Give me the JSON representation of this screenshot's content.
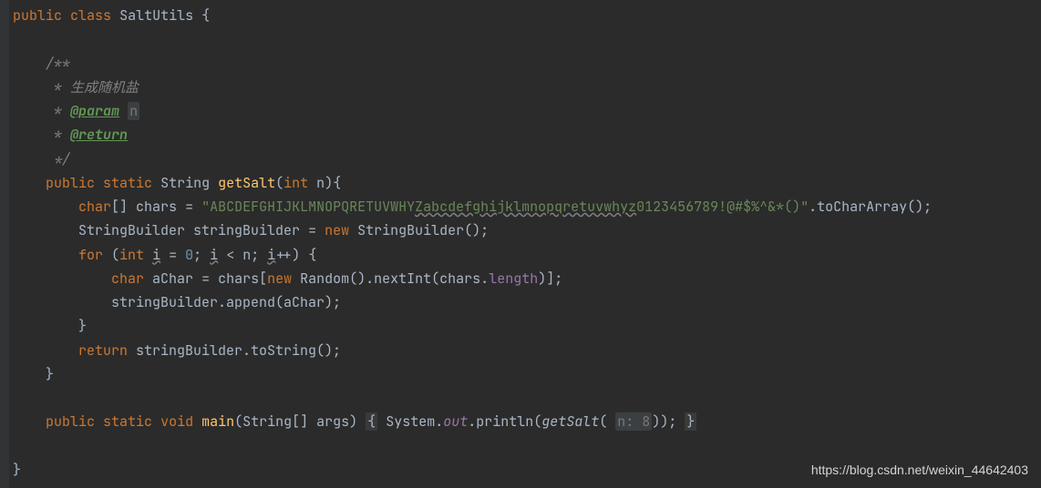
{
  "code": {
    "class_decl_public": "public",
    "class_decl_class": "class",
    "class_name": "SaltUtils",
    "brace_open": "{",
    "brace_close": "}",
    "doc_open": "/**",
    "doc_star": " *",
    "doc_desc": "生成随机盐",
    "doc_param_tag": "@param",
    "doc_param_name": "n",
    "doc_return_tag": "@return",
    "doc_close": " */",
    "m1_public": "public",
    "m1_static": "static",
    "m1_ret": "String",
    "m1_name": "getSalt",
    "m1_paren_open": "(",
    "m1_param_type": "int",
    "m1_param_name": "n",
    "m1_paren_close": ")",
    "char_kw": "char",
    "chars_var": "chars",
    "eq": "=",
    "charset_str_upper": "\"ABCDEFGHIJKLMNOPQRETUVWHY",
    "charset_str_lower": "Zabcdefghijklmnopqretuvwhyz",
    "charset_str_tail": "0123456789!@#$%^&*()\"",
    "to_char_array": ".toCharArray();",
    "sb_type": "StringBuilder",
    "sb_var": "stringBuilder",
    "new_kw": "new",
    "sb_ctor": "StringBuilder();",
    "for_kw": "for",
    "int_kw": "int",
    "i_var": "i",
    "zero": "0",
    "lt": "<",
    "n_var": "n",
    "inc": "++",
    "achar_var": "aChar",
    "chars_idx": "chars[",
    "random_type": "Random",
    "random_ctor": "().nextInt(chars.",
    "length_field": "length",
    "idx_close": ")];",
    "append_call": "stringBuilder.append(aChar);",
    "return_kw": "return",
    "tostring_call": "stringBuilder.toString();",
    "m2_ret": "void",
    "m2_name": "main",
    "m2_params": "(String[] args)",
    "fold_open": "{",
    "sys_out": "System.",
    "out_field": "out",
    "println": ".println(",
    "getsalt_call": "getSalt",
    "hint_label": "n:",
    "hint_val": "8",
    "call_close": "));",
    "fold_close": "}"
  },
  "watermark": "https://blog.csdn.net/weixin_44642403"
}
